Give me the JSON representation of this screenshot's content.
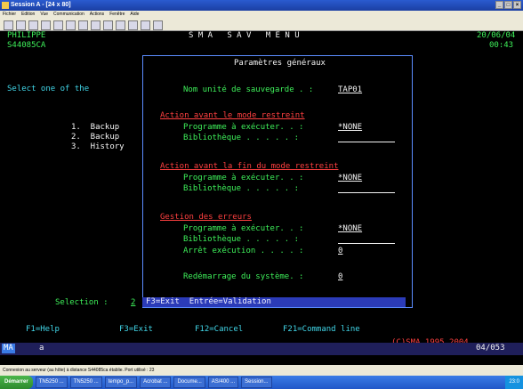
{
  "window": {
    "title": "Session A - [24 x 80]"
  },
  "menu": [
    "Fichier",
    "Edition",
    "Vue",
    "Communication",
    "Actions",
    "Fenêtre",
    "Aide"
  ],
  "screen": {
    "user": "PHILIPPE",
    "system": "S44085CA",
    "menu_title": "S M A   S A V   M E N U",
    "date": "20/06/04",
    "time": "00:43",
    "prompt": "Select one of the",
    "options": [
      "1.  Backup",
      "2.  Backup",
      "3.  History"
    ],
    "selection_label": "Selection :",
    "selection_value": "2",
    "fkeys": [
      "F1=Help",
      "F3=Exit",
      "F12=Cancel",
      "F21=Command line"
    ],
    "copyright": "(C)SMA 1995,2004",
    "cursor_pos": "04/053",
    "oia_left": "MA",
    "oia_a": "a"
  },
  "dialog": {
    "title": "Paramètres généraux",
    "unit_label": "Nom unité de sauvegarde . :",
    "unit_value": "TAP01",
    "section1": "Action avant le mode restreint",
    "section2": "Action avant la fin du mode restreint",
    "section3": "Gestion des erreurs",
    "prog_label": "Programme à exécuter. . :",
    "prog_value": "*NONE",
    "lib_label": "Bibliothèque . . . . . :",
    "lib_value": "",
    "stop_label": "Arrêt exécution . . . . :",
    "stop_value": "0",
    "restart_label": "Redémarrage du système. :",
    "restart_value": "0",
    "footer": "F3=Exit  Entrée=Validation"
  },
  "status_message": "Connexion au serveur (au hôte) à distance S44085ca établie. Port utilisé : 23",
  "taskbar": {
    "start": "Démarrer",
    "items": [
      "TN5250 ...",
      "TN5250 ...",
      "tempo_p...",
      "Acrobat ...",
      "Docume...",
      "AS/400 ...",
      "Session..."
    ],
    "clock": "23:0"
  }
}
